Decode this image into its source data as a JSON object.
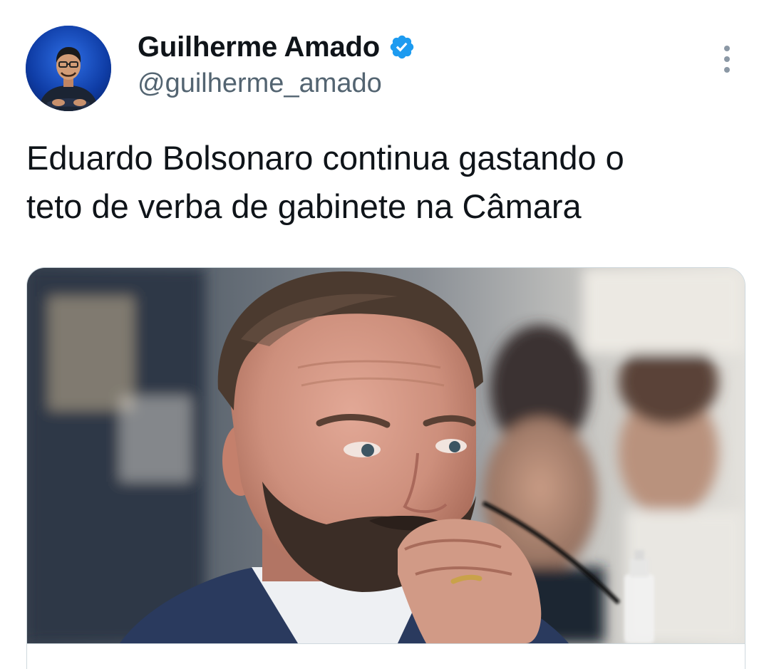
{
  "author": {
    "display_name": "Guilherme Amado",
    "handle": "@guilherme_amado",
    "verified": true,
    "avatar_icon": "profile-avatar",
    "verified_icon": "verified-badge-icon",
    "verified_color": "#1d9bf0"
  },
  "tweet": {
    "text": "Eduardo Bolsonaro continua gastando o\nteto de verba de gabinete na Câmara"
  },
  "card": {
    "image_icon": "news-photo"
  },
  "actions": {
    "more_icon": "more-options-icon"
  },
  "colors": {
    "text_primary": "#0f1419",
    "text_secondary": "#536471",
    "border": "#cfd9de",
    "avatar_background": "#1f5ad0"
  }
}
